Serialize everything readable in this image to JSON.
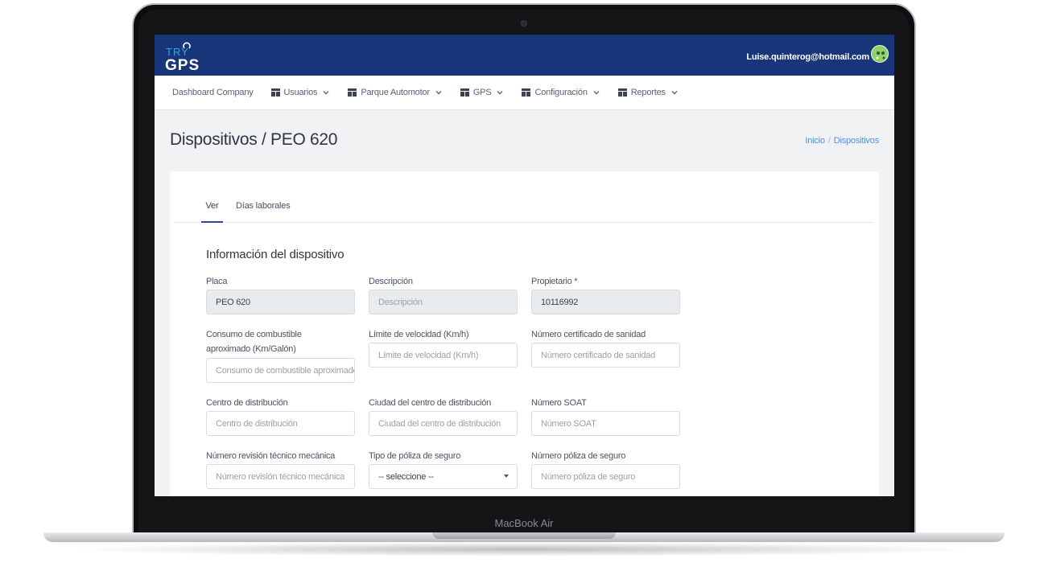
{
  "device_label": "MacBook Air",
  "header": {
    "logo_top": "TRY",
    "logo_bottom": "GPS",
    "user_email": "Luise.quinterog@hotmail.com"
  },
  "nav": {
    "items": [
      {
        "label": "Dashboard Company"
      },
      {
        "label": "Usuarios"
      },
      {
        "label": "Parque Automotor"
      },
      {
        "label": "GPS"
      },
      {
        "label": "Configuración"
      },
      {
        "label": "Reportes"
      }
    ]
  },
  "page": {
    "title": "Dispositivos / PEO 620",
    "breadcrumb": {
      "home": "Inicio",
      "sep": "/",
      "current": "Dispositivos"
    }
  },
  "tabs": {
    "ver": "Ver",
    "dias": "Días laborales"
  },
  "section": {
    "title": "Información del dispositivo"
  },
  "fields": {
    "placa": {
      "label": "Placa",
      "value": "PEO 620"
    },
    "descripcion": {
      "label": "Descripción",
      "placeholder": "Descripción"
    },
    "propietario": {
      "label": "Propietario *",
      "value": "10116992"
    },
    "consumo": {
      "label": "Consumo de combustible aproximado (Km/Galón)",
      "placeholder": "Consumo de combustible aproximado"
    },
    "limite": {
      "label": "Límite de velocidad (Km/h)",
      "placeholder": "Límite de velocidad (Km/h)"
    },
    "sanidad": {
      "label": "Número certificado de sanidad",
      "placeholder": "Número certificado de sanidad"
    },
    "centro": {
      "label": "Centro de distribución",
      "placeholder": "Centro de distribución"
    },
    "ciudad": {
      "label": "Ciudad del centro de distribución",
      "placeholder": "Ciudad del centro de distribución"
    },
    "soat": {
      "label": "Número SOAT",
      "placeholder": "Número SOAT"
    },
    "revision": {
      "label": "Número revisión técnico mecánica",
      "placeholder": "Número revisión técnico mecánica"
    },
    "tipo_poliza": {
      "label": "Tipo de póliza de seguro",
      "value": "-- seleccione --"
    },
    "num_poliza": {
      "label": "Número póliza de seguro",
      "placeholder": "Número póliza de seguro"
    }
  },
  "colors": {
    "header_bg": "#19367a",
    "link": "#4f8fe6",
    "avatar": "#8fd16a"
  },
  "icons": [
    "table-icon",
    "chevron-down-icon",
    "avatar-icon",
    "camera-icon"
  ]
}
